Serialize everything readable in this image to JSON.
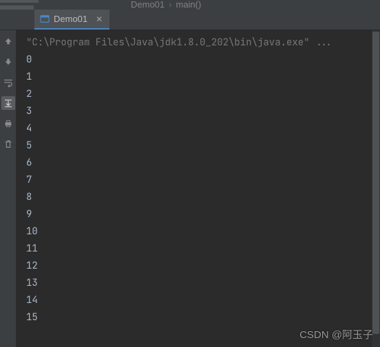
{
  "breadcrumb": {
    "class": "Demo01",
    "method": "main()"
  },
  "tabs": [
    {
      "label": "Demo01"
    }
  ],
  "toolbar": {
    "up": "Up the Stack Trace",
    "down": "Down the Stack Trace",
    "wrap": "Soft-Wrap",
    "scrollEnd": "Scroll to End",
    "print": "Print",
    "clear": "Clear All"
  },
  "console": {
    "command": "\"C:\\Program Files\\Java\\jdk1.8.0_202\\bin\\java.exe\" ...",
    "output": [
      0,
      1,
      2,
      3,
      4,
      5,
      6,
      7,
      8,
      9,
      10,
      11,
      12,
      13,
      14,
      15
    ]
  },
  "watermark": "CSDN @阿玉子"
}
